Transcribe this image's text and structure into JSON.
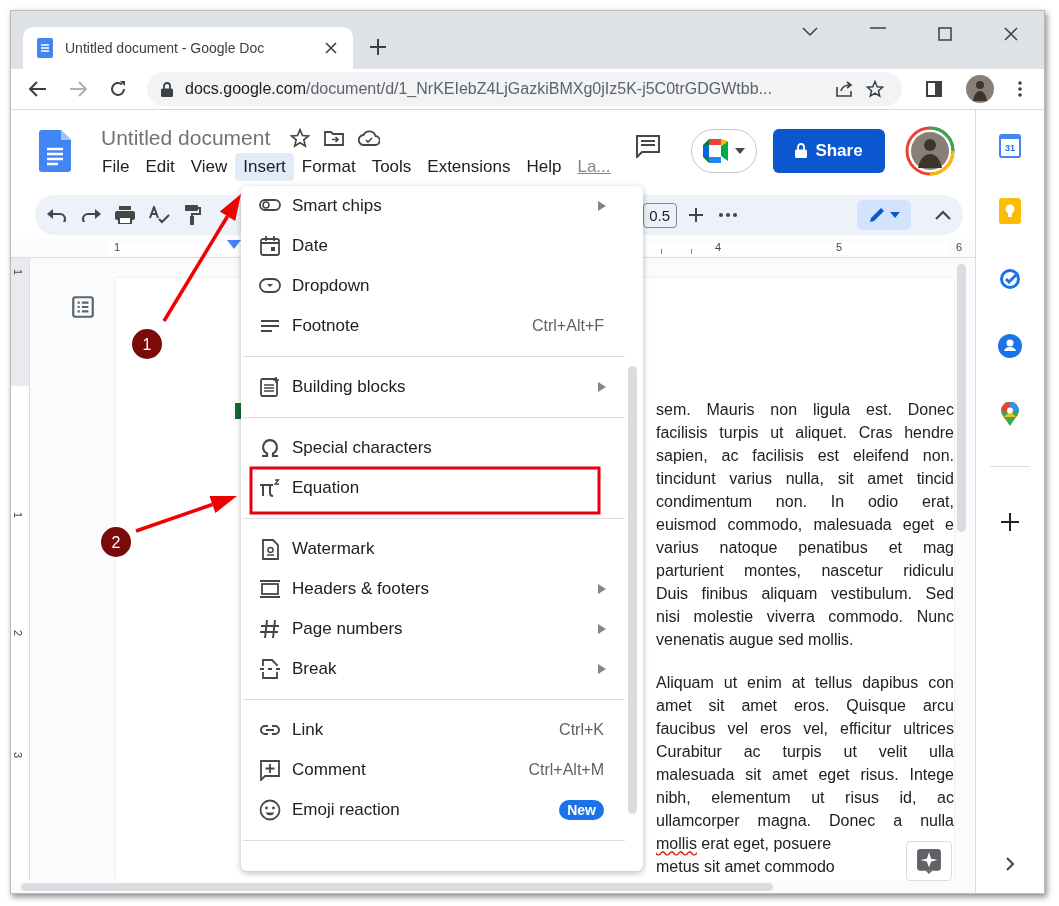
{
  "browser": {
    "tab": {
      "title": "Untitled document - Google Doc",
      "selected": true
    },
    "url": {
      "domain": "docs.google.com",
      "path": "/document/d/1_NrKEIebZ4LjGazkiBMXg0jIz5K-j5C0trGDGWtbb..."
    }
  },
  "docs": {
    "title": "Untitled document",
    "menus": [
      {
        "label": "File",
        "selected": false
      },
      {
        "label": "Edit",
        "selected": false
      },
      {
        "label": "View",
        "selected": false
      },
      {
        "label": "Insert",
        "selected": true
      },
      {
        "label": "Format",
        "selected": false
      },
      {
        "label": "Tools",
        "selected": false
      },
      {
        "label": "Extensions",
        "selected": false
      },
      {
        "label": "Help",
        "selected": false
      },
      {
        "label": "La...",
        "selected": false,
        "kind": "link"
      }
    ],
    "share": "Share"
  },
  "toolbar": {
    "font_size": "0.5"
  },
  "ruler": [
    "1",
    "4",
    "5",
    "6"
  ],
  "vertical_ruler": [
    "1",
    "1",
    "2",
    "3"
  ],
  "insert_menu": {
    "items": [
      {
        "kind": "item",
        "label": "Smart chips",
        "submenu": true
      },
      {
        "kind": "item",
        "label": "Date",
        "submenu": false
      },
      {
        "kind": "item",
        "label": "Dropdown",
        "submenu": false
      },
      {
        "kind": "item",
        "label": "Footnote",
        "shortcut": "Ctrl+Alt+F",
        "submenu": false
      },
      {
        "kind": "divider"
      },
      {
        "kind": "item",
        "label": "Building blocks",
        "submenu": true
      },
      {
        "kind": "divider"
      },
      {
        "kind": "item",
        "label": "Special characters",
        "submenu": false
      },
      {
        "kind": "item",
        "label": "Equation",
        "submenu": false
      },
      {
        "kind": "divider"
      },
      {
        "kind": "item",
        "label": "Watermark",
        "submenu": false
      },
      {
        "kind": "item",
        "label": "Headers & footers",
        "submenu": true
      },
      {
        "kind": "item",
        "label": "Page numbers",
        "submenu": true
      },
      {
        "kind": "item",
        "label": "Break",
        "submenu": true
      },
      {
        "kind": "divider"
      },
      {
        "kind": "item",
        "label": "Link",
        "shortcut": "Ctrl+K",
        "submenu": false
      },
      {
        "kind": "item",
        "label": "Comment",
        "shortcut": "Ctrl+Alt+M",
        "submenu": false
      },
      {
        "kind": "item",
        "label": "Emoji reaction",
        "badge": "New",
        "submenu": false
      },
      {
        "kind": "divider"
      }
    ]
  },
  "document": {
    "right_column": [
      [
        {
          "text": "sem. Mauris non ligula est. Donec"
        },
        {
          "text": "facilisis turpis ut aliquet. Cras hendre"
        },
        {
          "text": "sapien, ac facilisis est eleifend non."
        },
        {
          "text": "tincidunt varius nulla, sit amet tincid"
        },
        {
          "text": "condimentum non. In odio erat,"
        },
        {
          "text": "euismod commodo, malesuada eget e"
        },
        {
          "text": "varius natoque penatibus et mag"
        },
        {
          "text": "parturient montes, nascetur ridiculu"
        },
        {
          "text": "Duis finibus aliquam vestibulum. Sed"
        },
        {
          "text": "nisi molestie viverra commodo. Nunc"
        },
        {
          "text": "venenatis augue sed mollis.",
          "justified": false
        }
      ],
      [
        {
          "text": "Aliquam ut enim at tellus dapibus con"
        },
        {
          "text": "amet sit amet eros. Quisque arcu"
        },
        {
          "text": "faucibus vel eros vel, efficitur ultrices"
        },
        {
          "text": "Curabitur ac turpis ut velit ulla"
        },
        {
          "text": "malesuada sit amet eget risus. Intege"
        },
        {
          "text": "nibh, elementum ut risus id, ac"
        },
        {
          "text": "ullamcorper magna. Donec a nulla"
        },
        {
          "text": "mollis erat eget, posuere",
          "misspelled_first": true,
          "justified": false
        },
        {
          "text": "metus sit amet commodo",
          "justified": false
        }
      ]
    ]
  },
  "side_panel": {
    "calendar_day": "31"
  },
  "annotations": [
    {
      "kind": "arrow",
      "number": "1"
    },
    {
      "kind": "arrow",
      "number": "2"
    },
    {
      "kind": "highlight_box"
    }
  ]
}
